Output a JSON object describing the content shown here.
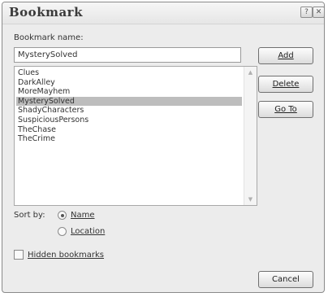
{
  "window": {
    "title": "Bookmark",
    "help_glyph": "?",
    "close_glyph": "✕"
  },
  "bookmark_name": {
    "label": "Bookmark name:",
    "value": "MysterySolved"
  },
  "bookmarks": {
    "items": [
      "Clues",
      "DarkAlley",
      "MoreMayhem",
      "MysterySolved",
      "ShadyCharacters",
      "SuspiciousPersons",
      "TheChase",
      "TheCrime"
    ],
    "selected": "MysterySolved"
  },
  "buttons": {
    "add": "Add",
    "delete": "Delete",
    "goto": "Go To",
    "cancel": "Cancel"
  },
  "sort": {
    "label": "Sort by:",
    "options": [
      "Name",
      "Location"
    ],
    "selected": "Name"
  },
  "hidden_bookmarks": {
    "label": "Hidden bookmarks",
    "checked": false
  },
  "icons": {
    "help": "help-icon",
    "close": "close-icon",
    "scroll_up": "scroll-up-arrow-icon",
    "scroll_down": "scroll-down-arrow-icon"
  },
  "colors": {
    "dialog_bg": "#ececec",
    "selection_bg": "#bdbdbd"
  }
}
